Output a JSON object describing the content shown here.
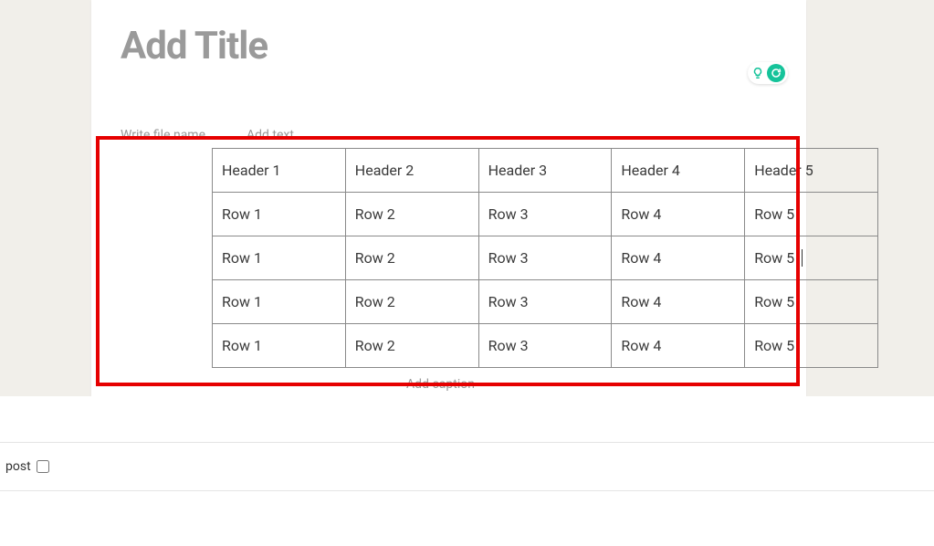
{
  "title_placeholder": "Add Title",
  "file_name_placeholder": "Write file name",
  "add_text_placeholder": "Add text",
  "caption_placeholder": "Add caption",
  "post_label": "post",
  "table": {
    "headers": [
      "Header 1",
      "Header 2",
      "Header 3",
      "Header 4",
      "Header 5"
    ],
    "rows": [
      [
        "Row 1",
        "Row 2",
        "Row 3",
        "Row 4",
        "Row 5"
      ],
      [
        "Row 1",
        "Row 2",
        "Row 3",
        "Row 4",
        "Row 5"
      ],
      [
        "Row 1",
        "Row 2",
        "Row 3",
        "Row 4",
        "Row 5"
      ],
      [
        "Row 1",
        "Row 2",
        "Row 3",
        "Row 4",
        "Row 5"
      ]
    ],
    "cursor_row": 1,
    "cursor_col": 4
  }
}
